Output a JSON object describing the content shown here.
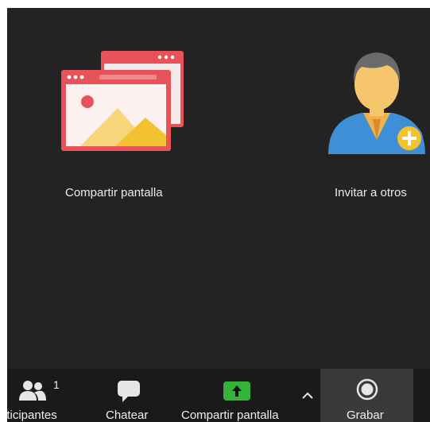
{
  "tiles": {
    "share_screen": {
      "label": "Compartir pantalla"
    },
    "invite_others": {
      "label": "Invitar a otros"
    }
  },
  "toolbar": {
    "participants": {
      "label": "Participantes",
      "count": "1"
    },
    "chat": {
      "label": "Chatear"
    },
    "share_screen": {
      "label": "Compartir pantalla"
    },
    "share_options_caret": "^",
    "record": {
      "label": "Grabar"
    }
  },
  "colors": {
    "background": "#232323",
    "toolbar": "#1a1a1a",
    "share_icon_red": "#e8535a",
    "share_button_green": "#33b33a",
    "invite_badge_yellow": "#f2c230",
    "avatar_blue": "#3e8fd6"
  },
  "icons": {
    "share_screen_tile": "share-screen-illustration-icon",
    "invite_tile": "invite-avatar-icon",
    "participants": "people-icon",
    "chat": "speech-bubble-icon",
    "share": "upload-arrow-icon",
    "caret": "chevron-up-icon",
    "record": "record-icon"
  }
}
